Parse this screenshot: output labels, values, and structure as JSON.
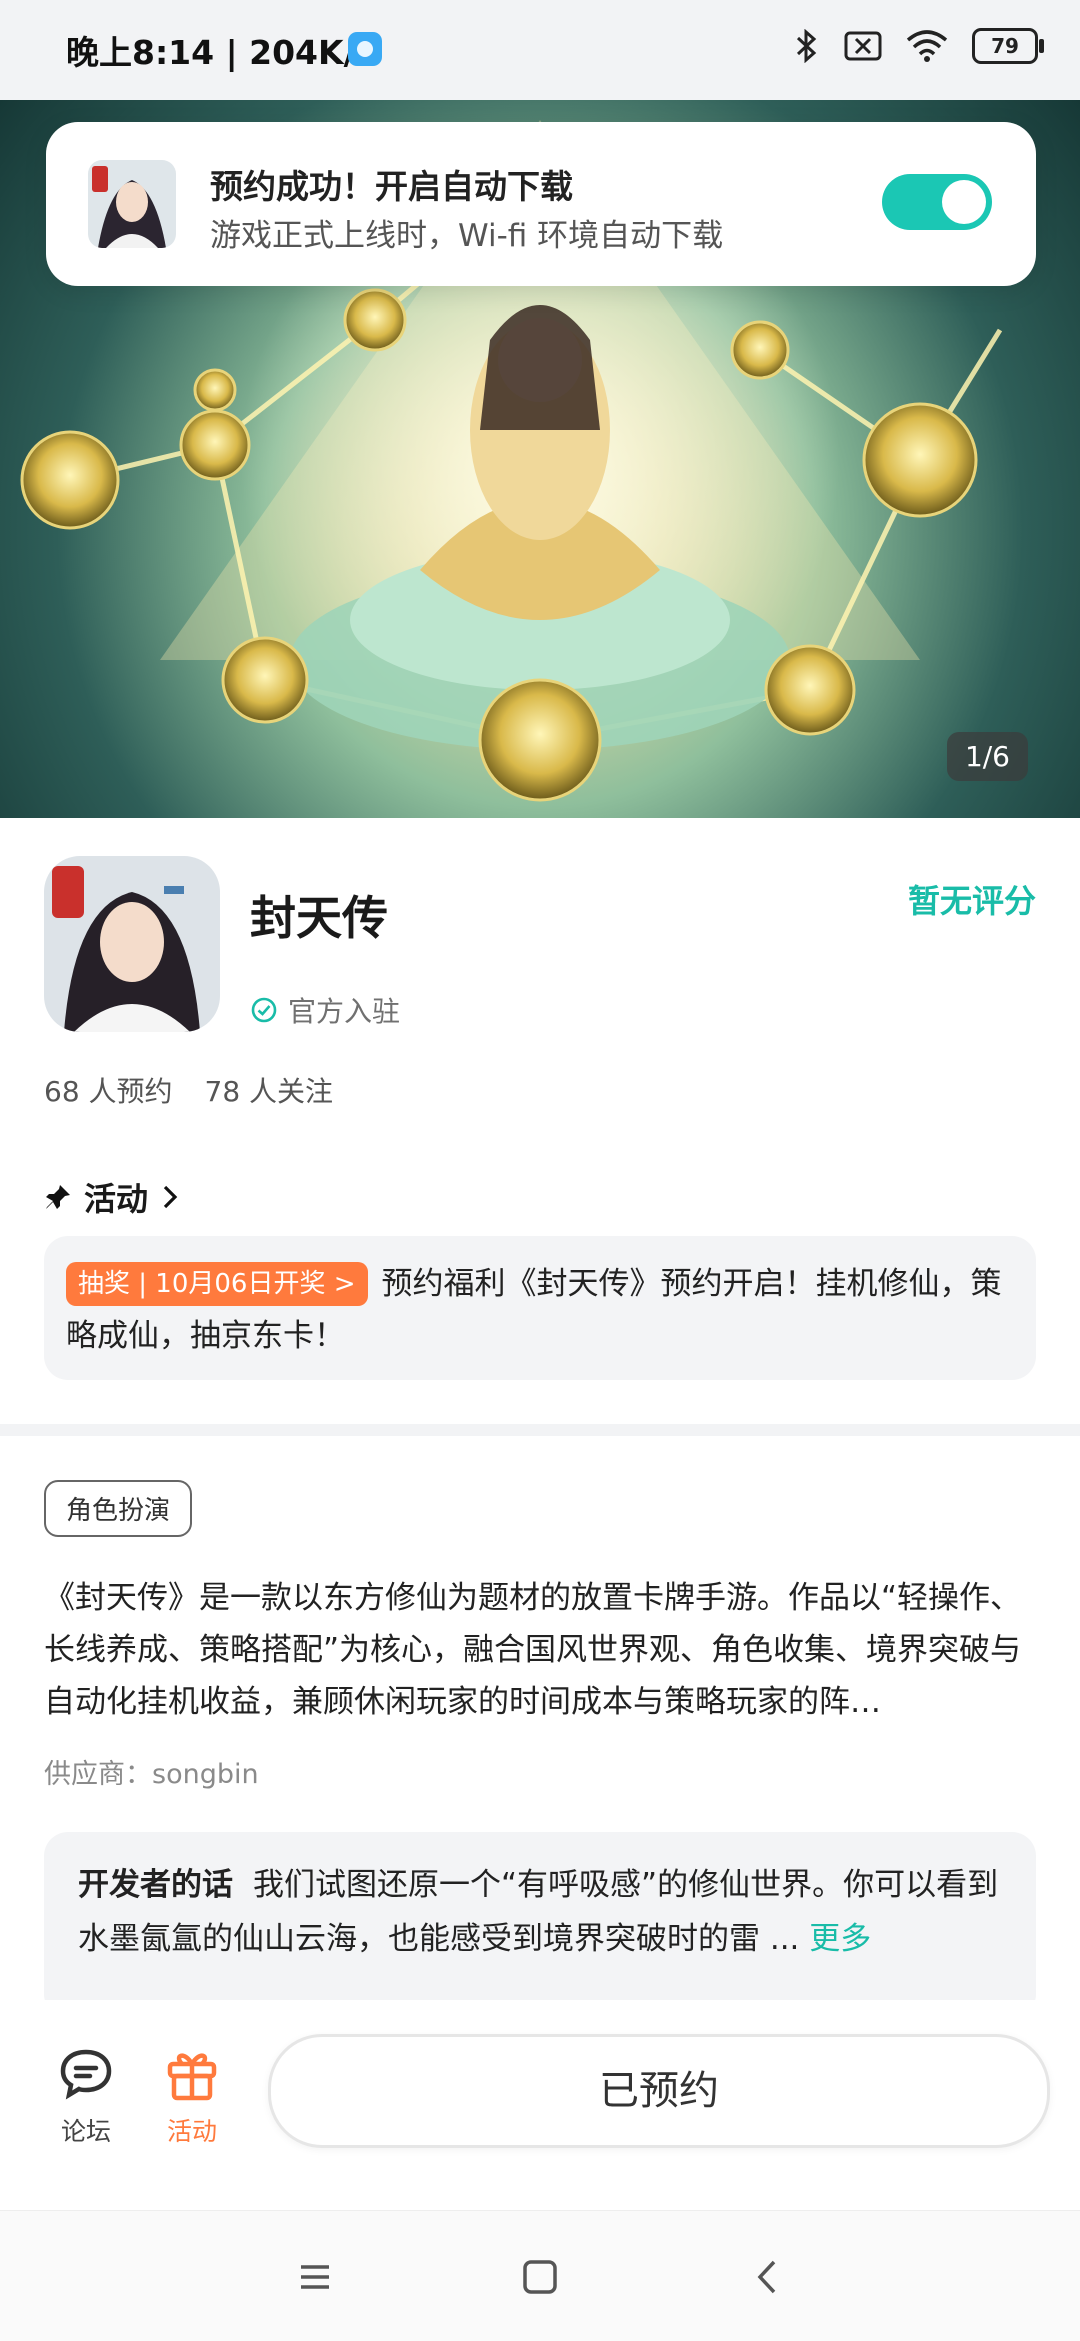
{
  "status_bar": {
    "time": "晚上8:14 | 204K/s",
    "battery": "79",
    "icons": [
      "bluetooth-icon",
      "sim-disabled-icon",
      "wifi-icon",
      "battery-icon"
    ]
  },
  "toast": {
    "title": "预约成功！开启自动下载",
    "subtitle": "游戏正式上线时，Wi-fi 环境自动下载",
    "toggle_on": true
  },
  "hero": {
    "page_indicator": "1/6"
  },
  "game": {
    "name": "封天传",
    "official_label": "官方入驻",
    "rating_text": "暂无评分",
    "reservations": "68 人预约",
    "followers": "78 人关注"
  },
  "activity": {
    "header": "活动",
    "badge": "抽奖 | 10月06日开奖 >",
    "text": "预约福利《封天传》预约开启！挂机修仙，策略成仙，抽京东卡！"
  },
  "details": {
    "tag": "角色扮演",
    "description": "《封天传》是一款以东方修仙为题材的放置卡牌手游。作品以“轻操作、长线养成、策略搭配”为核心，融合国风世界观、角色收集、境界突破与自动化挂机收益，兼顾休闲玩家的时间成本与策略玩家的阵…",
    "supplier": "供应商：songbin"
  },
  "developer": {
    "label": "开发者的话",
    "text": "我们试图还原一个“有呼吸感”的修仙世界。你可以看到水墨氤氲的仙山云海，也能感受到境界突破时的雷 ...",
    "more": "更多"
  },
  "bottom": {
    "forum_label": "论坛",
    "activity_label": "活动",
    "reserve_button": "已预约"
  },
  "colors": {
    "accent": "#19bca8",
    "orange": "#ff7a3d"
  }
}
